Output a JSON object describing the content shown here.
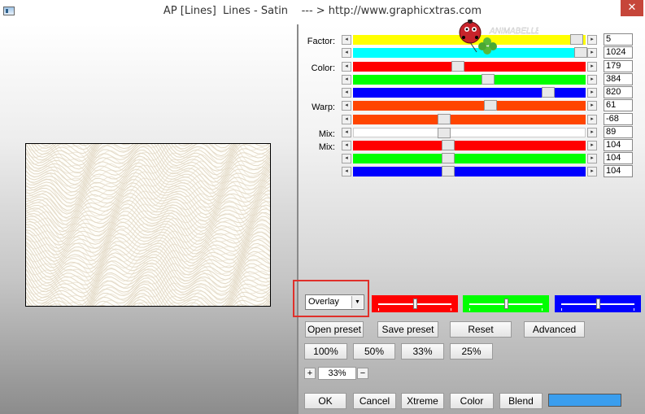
{
  "window": {
    "title": "AP [Lines]  Lines - Satin    --- > http://www.graphicxtras.com",
    "close_glyph": "✕"
  },
  "watermark": "ANIMABELLE",
  "labels": {
    "factor": "Factor:",
    "color": "Color:",
    "warp": "Warp:",
    "mix1": "Mix:",
    "mix2": "Mix:"
  },
  "sliders": [
    {
      "value": "5",
      "color": "#ffff00",
      "position": 0.96
    },
    {
      "value": "1024",
      "color": "#00ffff",
      "position": 0.98
    },
    {
      "value": "179",
      "color": "#ff0000",
      "position": 0.45
    },
    {
      "value": "384",
      "color": "#00ff00",
      "position": 0.58
    },
    {
      "value": "820",
      "color": "#0000ff",
      "position": 0.84
    },
    {
      "value": "61",
      "color": "#ff4500",
      "position": 0.59
    },
    {
      "value": "-68",
      "color": "#ff4500",
      "position": 0.39
    },
    {
      "value": "89",
      "color": "#ffffff",
      "position": 0.39
    },
    {
      "value": "104",
      "color": "#ff0000",
      "position": 0.41
    },
    {
      "value": "104",
      "color": "#00ff00",
      "position": 0.41
    },
    {
      "value": "104",
      "color": "#0000ff",
      "position": 0.41
    }
  ],
  "blend_mode": {
    "selected": "Overlay"
  },
  "color_sliders": [
    {
      "name": "red",
      "color": "#ff0000",
      "position": 0.5
    },
    {
      "name": "green",
      "color": "#00ff00",
      "position": 0.5
    },
    {
      "name": "blue",
      "color": "#0000ff",
      "position": 0.5
    }
  ],
  "buttons": {
    "open_preset": "Open preset",
    "save_preset": "Save preset",
    "reset": "Reset",
    "advanced": "Advanced",
    "zoom_100": "100%",
    "zoom_50": "50%",
    "zoom_33": "33%",
    "zoom_25": "25%",
    "zoom_plus": "+",
    "zoom_minus": "−",
    "ok": "OK",
    "cancel": "Cancel",
    "xtreme": "Xtreme",
    "color": "Color",
    "blend": "Blend"
  },
  "zoom_value": "33%",
  "blend_color": "#3a9eee"
}
